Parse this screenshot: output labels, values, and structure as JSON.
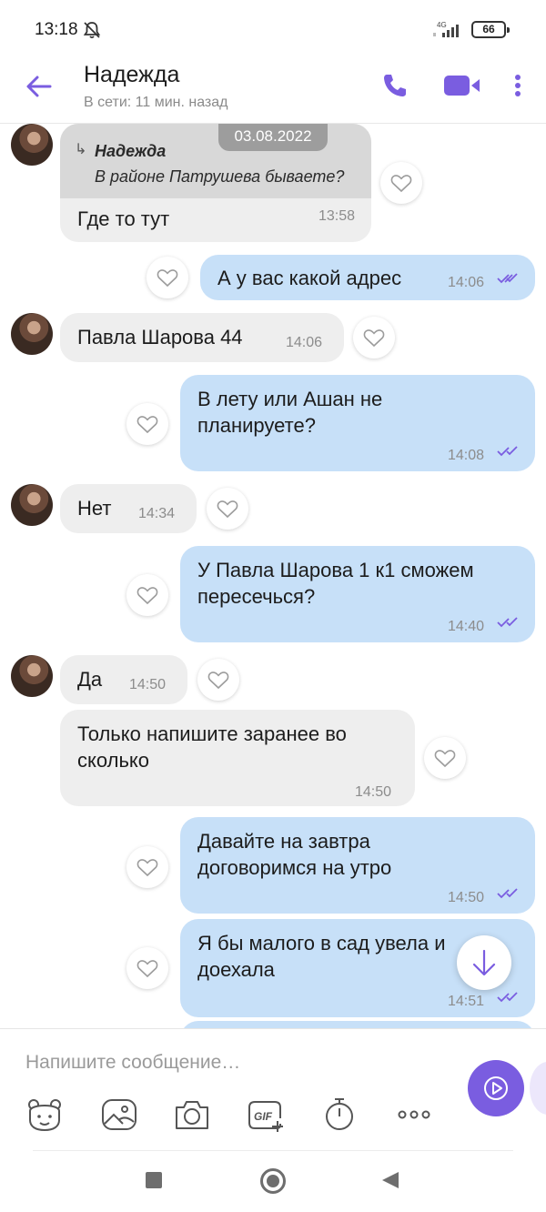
{
  "status_bar": {
    "time": "13:18",
    "network_label": "4G",
    "battery": "66"
  },
  "header": {
    "contact_name": "Надежда",
    "contact_status": "В сети: 11 мин. назад"
  },
  "date_chip": "03.08.2022",
  "messages": [
    {
      "direction": "in",
      "reply_to": {
        "name": "Надежда",
        "text": "В районе Патрушева бываете?"
      },
      "text": "Где то тут",
      "time": "13:58"
    },
    {
      "direction": "out",
      "text": "А у вас какой адрес",
      "time": "14:06",
      "read": true
    },
    {
      "direction": "in",
      "text": "Павла Шарова 44",
      "time": "14:06"
    },
    {
      "direction": "out",
      "lines": [
        "В лету или Ашан не",
        "планируете?"
      ],
      "time": "14:08",
      "read": true
    },
    {
      "direction": "in",
      "text": "Нет",
      "time": "14:34"
    },
    {
      "direction": "out",
      "lines": [
        "У Павла Шарова 1 к1 сможем",
        "пересечься?"
      ],
      "time": "14:40",
      "read": true
    },
    {
      "direction": "in",
      "text": "Да",
      "time": "14:50"
    },
    {
      "direction": "in",
      "lines": [
        "Только напишите заранее во",
        "сколько"
      ],
      "time": "14:50"
    },
    {
      "direction": "out",
      "lines": [
        "Давайте на завтра",
        "договоримся на утро"
      ],
      "time": "14:50",
      "read": true
    },
    {
      "direction": "out",
      "lines": [
        "Я бы малого в сад увела и",
        "доехала"
      ],
      "time": "14:51",
      "read": true
    }
  ],
  "composer": {
    "placeholder": "Напишите сообщение…",
    "value": "",
    "gif_label": "GIF",
    "toolbar_icons": [
      "sticker-icon",
      "gallery-icon",
      "camera-icon",
      "gif-icon",
      "timer-icon",
      "more-options-icon"
    ]
  },
  "colors": {
    "accent": "#7a5de0",
    "incoming_bubble": "#eeeeee",
    "outgoing_bubble": "#c7e0f8",
    "reply_block": "#d8d8d8",
    "date_chip": "#9d9d9d"
  }
}
